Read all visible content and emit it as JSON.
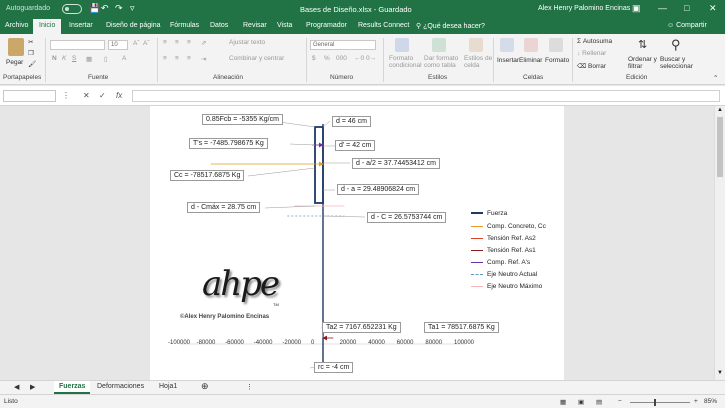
{
  "titlebar": {
    "autosave_label": "Autoguardado",
    "doc_title": "Bases de Diseño.xlsx  -  Guardado",
    "user_name": "Alex Henry Palomino Encinas"
  },
  "tabs": [
    "Archivo",
    "Inicio",
    "Insertar",
    "Diseño de página",
    "Fórmulas",
    "Datos",
    "Revisar",
    "Vista",
    "Programador",
    "Results Connect"
  ],
  "tell_me": "¿Qué desea hacer?",
  "share": "Compartir",
  "ribbon": {
    "paste": "Pegar",
    "clipboard": "Portapapeles",
    "font_group": "Fuente",
    "font_size": "10",
    "alignment_group": "Alineación",
    "wrap_text": "Ajustar texto",
    "merge_center": "Combinar y centrar",
    "number_group": "Número",
    "number_format": "General",
    "styles_group": "Estilos",
    "conditional_format": [
      "Formato",
      "condicional"
    ],
    "format_table": [
      "Dar formato",
      "como tabla"
    ],
    "cell_styles": [
      "Estilos de",
      "celda"
    ],
    "cells_group": "Celdas",
    "insert": "Insertar",
    "delete": "Eliminar",
    "format": "Formato",
    "editing_group": "Edición",
    "autosum": "Autosuma",
    "fill": "Rellenar",
    "clear": "Borrar",
    "sort_filter": [
      "Ordenar y",
      "filtrar"
    ],
    "find_select": [
      "Buscar y",
      "seleccionar"
    ]
  },
  "formula_bar": {
    "fx": "fx",
    "name_box": "",
    "content": ""
  },
  "chart_data": {
    "type": "line",
    "x_ticks": [
      "-100000",
      "-80000",
      "-60000",
      "-40000",
      "-20000",
      "0",
      "20000",
      "40000",
      "60000",
      "80000",
      "100000"
    ],
    "xlim": [
      -100000,
      100000
    ],
    "legend": [
      {
        "name": "Fuerza",
        "color": "#1f3864",
        "style": "solid"
      },
      {
        "name": "Comp. Concreto, Cc",
        "color": "#e69c24",
        "style": "arrow"
      },
      {
        "name": "Tensión Ref. As2",
        "color": "#e0402a",
        "style": "arrow"
      },
      {
        "name": "Tensión Ref. As1",
        "color": "#8b1a1a",
        "style": "arrow"
      },
      {
        "name": "Comp. Ref. A's",
        "color": "#7030a0",
        "style": "arrow"
      },
      {
        "name": "Eje Neutro Actual",
        "color": "#5b9bd5",
        "style": "dashed"
      },
      {
        "name": "Eje Neutro Máximo",
        "color": "#f4b6b6",
        "style": "solid"
      }
    ],
    "annotations": [
      {
        "key": "fcb",
        "text": "0.85Fcb = -5355 Kg/cm"
      },
      {
        "key": "d",
        "text": "d = 46 cm"
      },
      {
        "key": "ts",
        "text": "T's = -7485.798675 Kg"
      },
      {
        "key": "dprime",
        "text": "d' = 42 cm"
      },
      {
        "key": "da2",
        "text": "d - a/2 = 37.74453412 cm"
      },
      {
        "key": "cc",
        "text": "Cc = -78517.6875 Kg"
      },
      {
        "key": "da",
        "text": "d - a = 29.48906824 cm"
      },
      {
        "key": "dcmax",
        "text": "d - Cmáx = 28.75 cm"
      },
      {
        "key": "dc",
        "text": "d - C = 26.5753744 cm"
      },
      {
        "key": "ta2",
        "text": "Ta2 = 7167.652231 Kg"
      },
      {
        "key": "ta1",
        "text": "Ta1 = 78517.6875 Kg"
      },
      {
        "key": "rc",
        "text": "rc = -4 cm"
      }
    ]
  },
  "logo": {
    "text": "ahpe",
    "tm": "TM",
    "copyright": "©Alex Henry Palomino Encinas"
  },
  "sheets": [
    "Fuerzas",
    "Deformaciones",
    "Hoja1"
  ],
  "status": {
    "ready": "Listo",
    "zoom": "85%"
  }
}
